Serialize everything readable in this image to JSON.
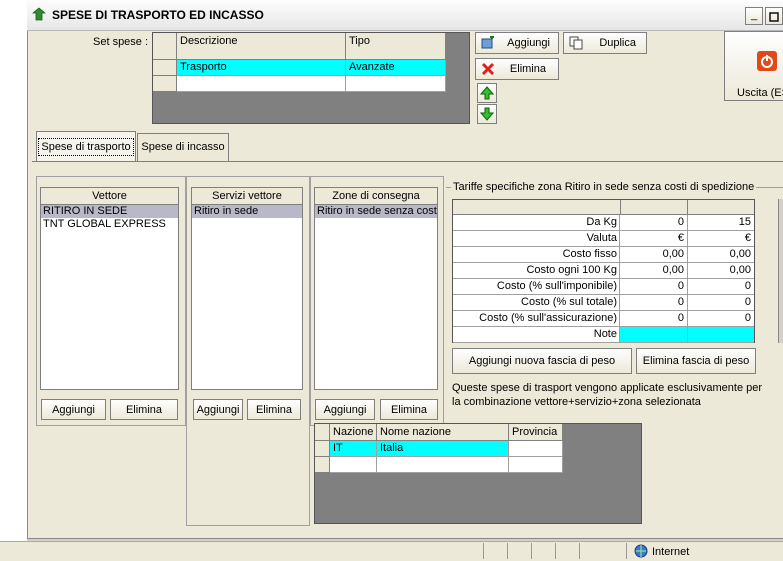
{
  "window": {
    "title": "SPESE DI TRASPORTO ED INCASSO"
  },
  "set_spese": {
    "label": "Set spese :",
    "columns": [
      "Descrizione",
      "Tipo"
    ],
    "rows": [
      {
        "descrizione": "Trasporto",
        "tipo": "Avanzate"
      }
    ]
  },
  "toolbar": {
    "aggiungi": "Aggiungi",
    "duplica": "Duplica",
    "elimina": "Elimina",
    "uscita": "Uscita (ES"
  },
  "tabs": [
    {
      "label": "Spese di trasporto"
    },
    {
      "label": "Spese di incasso"
    }
  ],
  "vettore": {
    "header": "Vettore",
    "items": [
      "RITIRO IN SEDE",
      "TNT GLOBAL EXPRESS"
    ],
    "btn_add": "Aggiungi",
    "btn_del": "Elimina"
  },
  "servizi": {
    "header": "Servizi vettore",
    "items": [
      "Ritiro in sede"
    ],
    "btn_add": "Aggiungi",
    "btn_del": "Elimina"
  },
  "zone": {
    "header": "Zone di consegna",
    "items": [
      "Ritiro in sede senza costi"
    ],
    "btn_add": "Aggiungi",
    "btn_del": "Elimina"
  },
  "nazioni": {
    "columns": [
      "Nazione",
      "Nome nazione",
      "Provincia"
    ],
    "rows": [
      {
        "nazione": "IT",
        "nome": "Italia",
        "provincia": ""
      }
    ]
  },
  "tariffe": {
    "group_title": "Tariffe specifiche zona Ritiro in sede senza costi di spedizione",
    "rows": [
      {
        "label": "Da Kg",
        "v1": "0",
        "v2": "15"
      },
      {
        "label": "Valuta",
        "v1": "€",
        "v2": "€"
      },
      {
        "label": "Costo fisso",
        "v1": "0,00",
        "v2": "0,00"
      },
      {
        "label": "Costo ogni 100 Kg",
        "v1": "0,00",
        "v2": "0,00"
      },
      {
        "label": "Costo (% sull'imponibile)",
        "v1": "0",
        "v2": "0"
      },
      {
        "label": "Costo (% sul totale)",
        "v1": "0",
        "v2": "0"
      },
      {
        "label": "Costo (% sull'assicurazione)",
        "v1": "0",
        "v2": "0"
      },
      {
        "label": "Note",
        "v1": "",
        "v2": ""
      }
    ],
    "btn_add_fascia": "Aggiungi nuova fascia di peso",
    "btn_del_fascia": "Elimina fascia di peso",
    "info": "Queste spese di trasport vengono applicate esclusivamente per la combinazione vettore+servizio+zona selezionata"
  },
  "statusbar": {
    "zone": "Internet"
  },
  "colors": {
    "selection": "#00ffff",
    "window_bg": "#ece9d8",
    "grid_bg": "#808080"
  }
}
